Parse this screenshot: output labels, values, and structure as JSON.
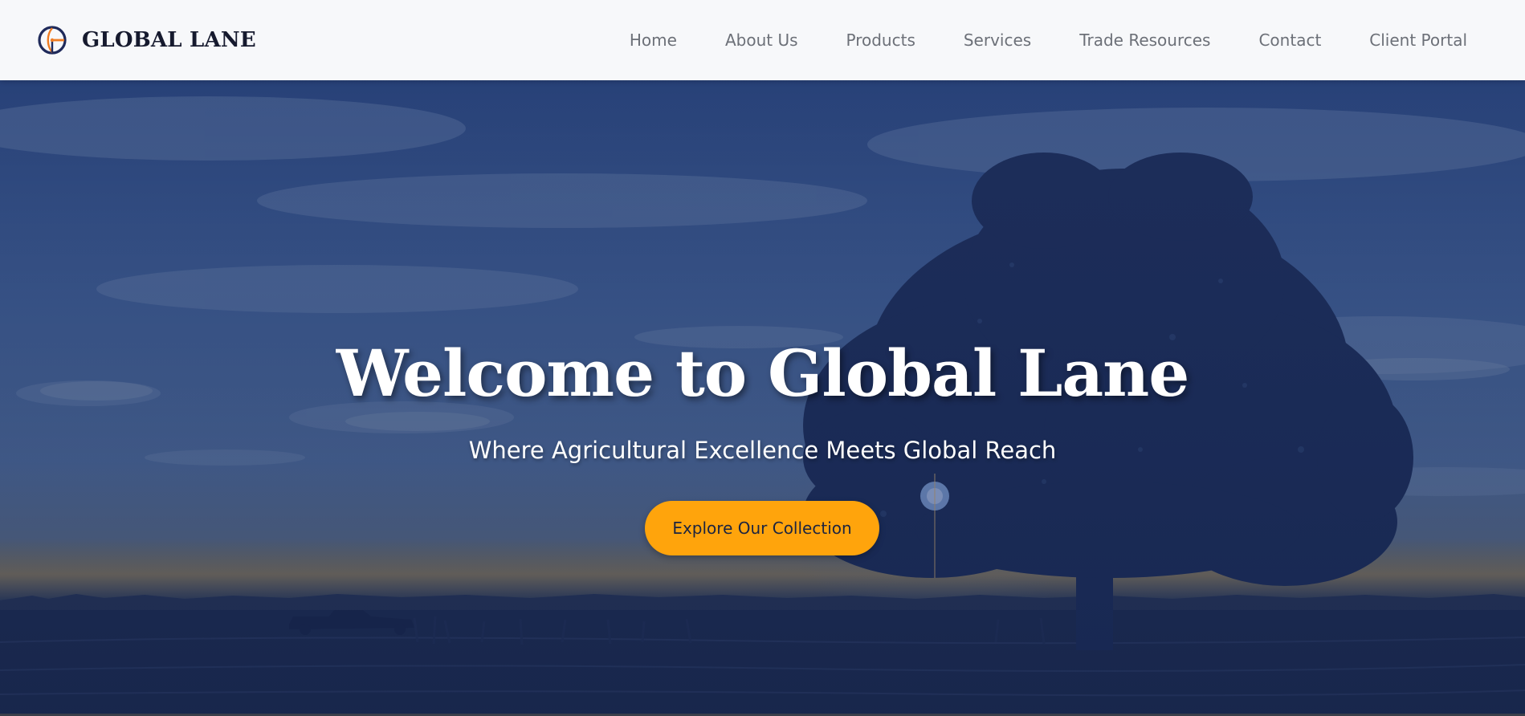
{
  "brand": {
    "name": "GLOBAL LANE",
    "logo_icon": "compass-globe-logo-icon",
    "colors": {
      "ring": "#1f2a5a",
      "accent": "#ef7d24"
    }
  },
  "nav": {
    "items": [
      {
        "label": "Home"
      },
      {
        "label": "About Us"
      },
      {
        "label": "Products"
      },
      {
        "label": "Services"
      },
      {
        "label": "Trade Resources"
      },
      {
        "label": "Contact"
      },
      {
        "label": "Client Portal"
      }
    ]
  },
  "hero": {
    "title": "Welcome to Global Lane",
    "subtitle": "Where Agricultural Excellence Meets Global Reach",
    "cta_label": "Explore Our Collection",
    "background": "sunset-field-with-oak-tree-and-truck",
    "overlay_color": "#1a2d5e",
    "cta_color": "#ffa40c"
  }
}
